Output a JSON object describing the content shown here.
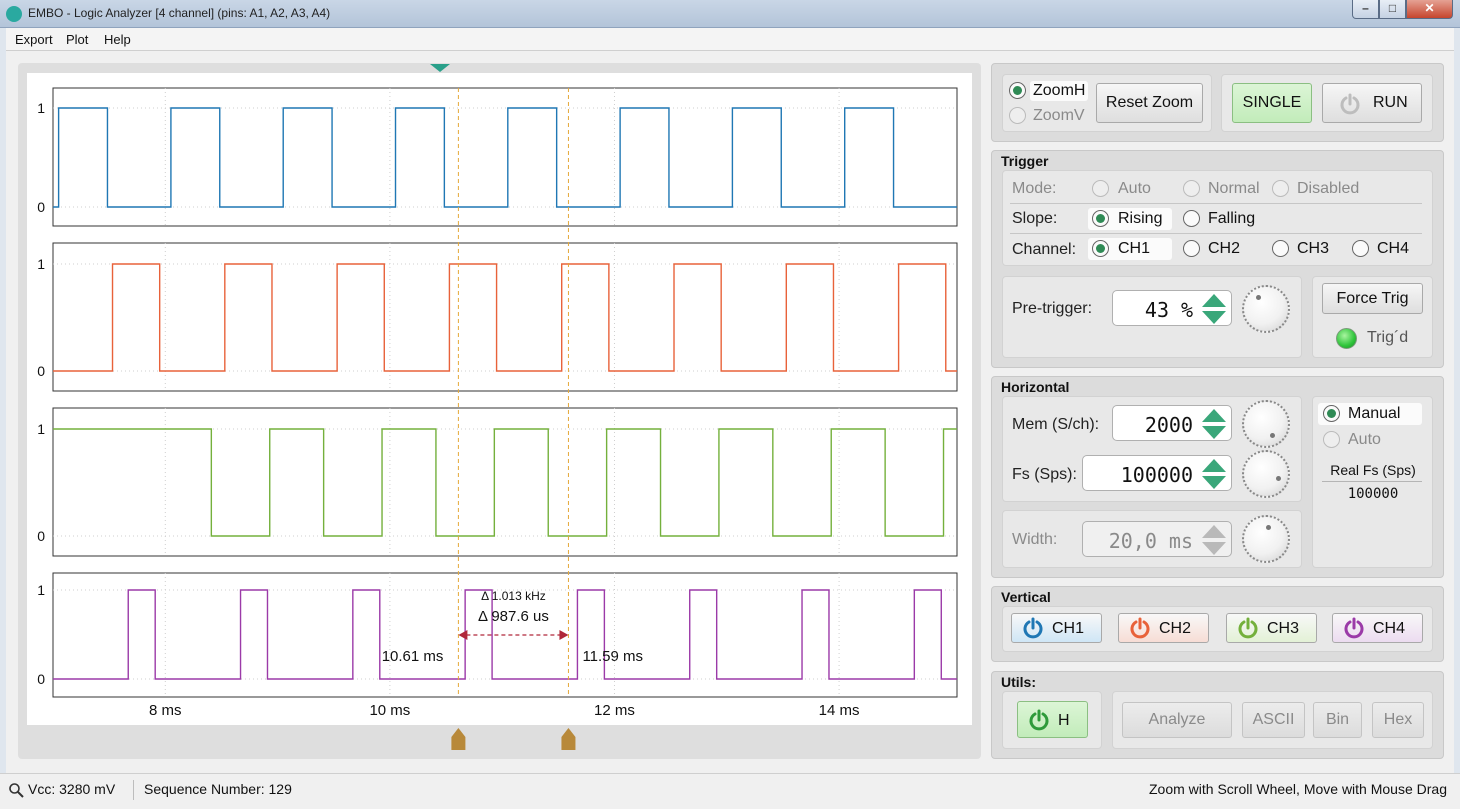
{
  "window": {
    "title": "EMBO - Logic Analyzer [4 channel] (pins: A1, A2, A3, A4)"
  },
  "menu": {
    "items": [
      "Export",
      "Plot",
      "Help"
    ]
  },
  "plot": {
    "channels": [
      {
        "name": "CH1",
        "color": "#1f77b4",
        "ymin_label": "0",
        "ymax_label": "1"
      },
      {
        "name": "CH2",
        "color": "#e8623a",
        "ymin_label": "0",
        "ymax_label": "1"
      },
      {
        "name": "CH3",
        "color": "#74b03c",
        "ymin_label": "0",
        "ymax_label": "1"
      },
      {
        "name": "CH4",
        "color": "#9b3aa8",
        "ymin_label": "0",
        "ymax_label": "1"
      }
    ],
    "x_ticks": [
      "8 ms",
      "10 ms",
      "12 ms",
      "14 ms"
    ],
    "x_range_ms": [
      7.0,
      15.05
    ],
    "cursor1": {
      "time_ms": 10.61,
      "label": "10.61 ms"
    },
    "cursor2": {
      "time_ms": 11.59,
      "label": "11.59 ms"
    },
    "delta_freq": "Δ 1.013 kHz",
    "delta_time": "Δ 987.6 us",
    "cursor_color": "#e5a93a",
    "cursor_marker_color": "#b8893a",
    "trigger_marker_color": "#2aa08a"
  },
  "controls": {
    "zoomh": "ZoomH",
    "zoomv": "ZoomV",
    "reset_zoom": "Reset Zoom",
    "single": "SINGLE",
    "run": "RUN"
  },
  "trigger": {
    "title": "Trigger",
    "mode_label": "Mode:",
    "modes": [
      "Auto",
      "Normal",
      "Disabled"
    ],
    "slope_label": "Slope:",
    "slopes": [
      "Rising",
      "Falling"
    ],
    "selected_slope": "Rising",
    "channel_label": "Channel:",
    "channels": [
      "CH1",
      "CH2",
      "CH3",
      "CH4"
    ],
    "selected_channel": "CH1",
    "pretrigger_label": "Pre-trigger:",
    "pretrigger_value": "43",
    "pretrigger_unit": "%",
    "force_trig": "Force Trig",
    "trigd_label": "Trig´d",
    "trigd_led_color": "#2ec43a"
  },
  "horizontal": {
    "title": "Horizontal",
    "mem_label": "Mem (S/ch):",
    "mem_value": "2000",
    "fs_label": "Fs (Sps):",
    "fs_value": "100000",
    "width_label": "Width:",
    "width_value": "20,0 ms",
    "manual": "Manual",
    "auto": "Auto",
    "real_fs_label": "Real Fs (Sps)",
    "real_fs_value": "100000"
  },
  "vertical": {
    "title": "Vertical",
    "buttons": [
      {
        "label": "CH1",
        "color": "#1f77b4",
        "bg": "#cfe6f6"
      },
      {
        "label": "CH2",
        "color": "#e8623a",
        "bg": "#f7ddd5"
      },
      {
        "label": "CH3",
        "color": "#74b03c",
        "bg": "#e3f1d6"
      },
      {
        "label": "CH4",
        "color": "#9b3aa8",
        "bg": "#ecdcf0"
      }
    ]
  },
  "utils": {
    "title": "Utils:",
    "h_button": "H",
    "analyze": "Analyze",
    "ascii": "ASCII",
    "bin": "Bin",
    "hex": "Hex"
  },
  "status": {
    "vcc": "Vcc: 3280 mV",
    "sequence": "Sequence Number: 129",
    "hint": "Zoom with Scroll Wheel, Move with Mouse Drag"
  }
}
